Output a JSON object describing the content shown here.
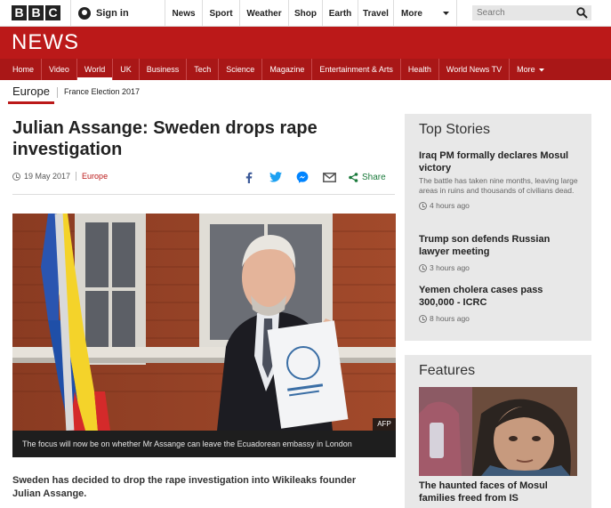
{
  "bbc_logo": [
    "B",
    "B",
    "C"
  ],
  "account": {
    "signin_label": "Sign in",
    "icon": "user-icon"
  },
  "top_nav": [
    {
      "label": "News"
    },
    {
      "label": "Sport"
    },
    {
      "label": "Weather"
    },
    {
      "label": "Shop"
    },
    {
      "label": "Earth"
    },
    {
      "label": "Travel"
    },
    {
      "label": "More",
      "icon": "chevron-down-icon"
    }
  ],
  "search": {
    "placeholder": "Search",
    "icon": "search-icon"
  },
  "brand": {
    "wordmark": "NEWS",
    "color": "#bb1919"
  },
  "news_nav": {
    "items": [
      "Home",
      "Video",
      "World",
      "UK",
      "Business",
      "Tech",
      "Science",
      "Magazine",
      "Entertainment & Arts",
      "Health",
      "World News TV",
      "More"
    ],
    "active": "World",
    "more_icon": "chevron-down-icon"
  },
  "sub_nav": {
    "section": "Europe",
    "items": [
      "France Election 2017"
    ]
  },
  "article": {
    "headline": "Julian Assange: Sweden drops rape investigation",
    "date": "19 May 2017",
    "category": "Europe",
    "share_label": "Share",
    "share_icons": [
      "facebook-icon",
      "twitter-icon",
      "messenger-icon",
      "email-icon",
      "share-icon"
    ],
    "image_credit": "AFP",
    "image_caption": "The focus will now be on whether Mr Assange can leave the Ecuadorean embassy in London",
    "lede": "Sweden has decided to drop the rape investigation into Wikileaks founder Julian Assange."
  },
  "top_stories": {
    "heading": "Top Stories",
    "items": [
      {
        "title": "Iraq PM formally declares Mosul victory",
        "summary": "The battle has taken nine months, leaving large areas in ruins and thousands of civilians dead.",
        "time": "4 hours ago"
      },
      {
        "title": "Trump son defends Russian lawyer meeting",
        "summary": "",
        "time": "3 hours ago"
      },
      {
        "title": "Yemen cholera cases pass 300,000 - ICRC",
        "summary": "",
        "time": "8 hours ago"
      }
    ]
  },
  "features": {
    "heading": "Features",
    "items": [
      {
        "title": "The haunted faces of Mosul families freed from IS"
      }
    ]
  }
}
